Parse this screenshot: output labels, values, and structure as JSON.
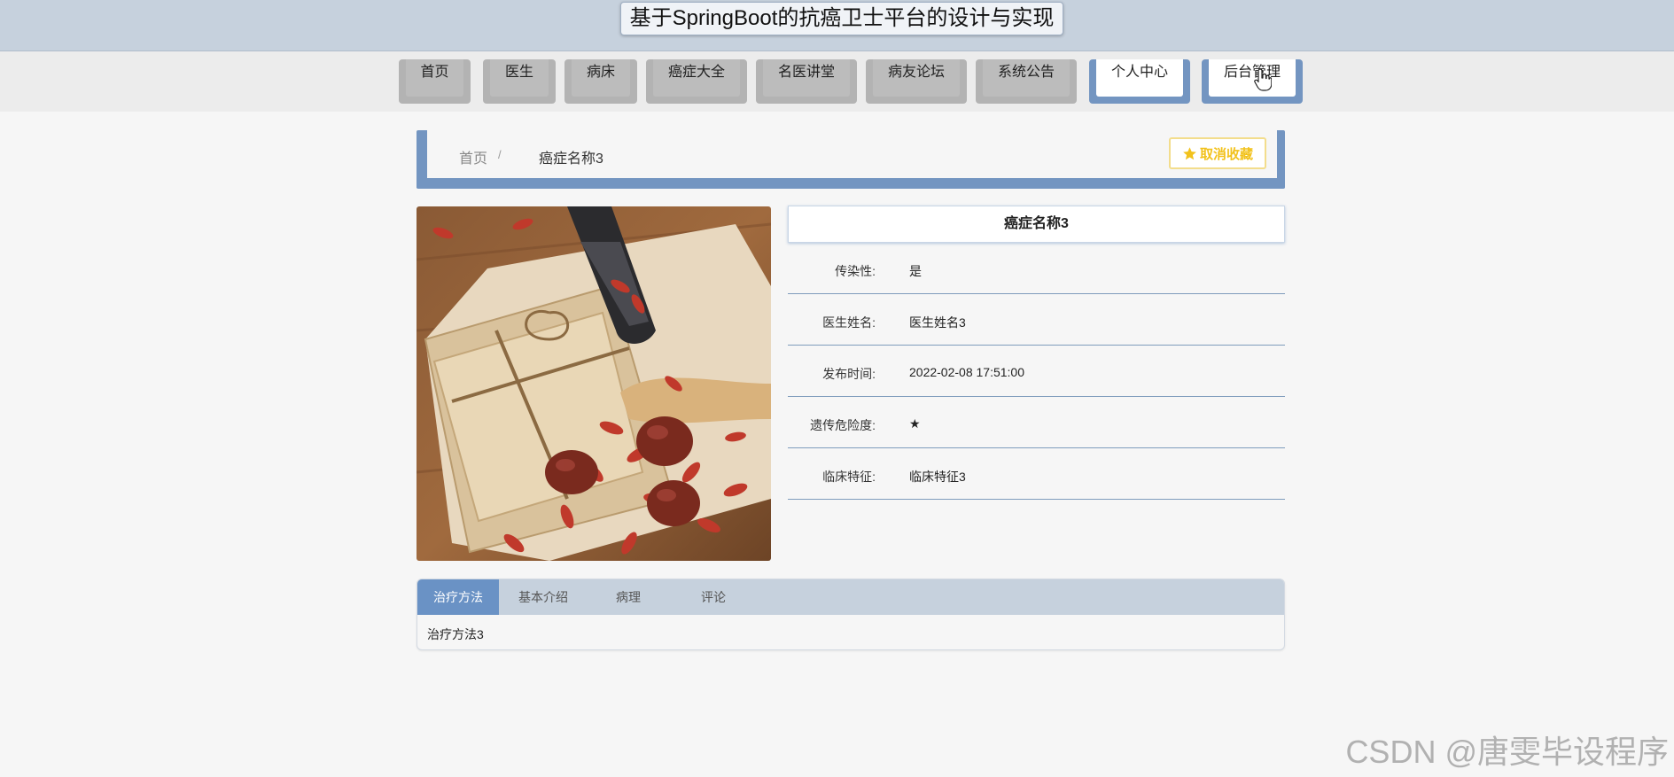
{
  "header": {
    "title": "基于SpringBoot的抗癌卫士平台的设计与实现"
  },
  "nav": {
    "items": [
      {
        "label": "首页",
        "active": false
      },
      {
        "label": "医生",
        "active": false
      },
      {
        "label": "病床",
        "active": false
      },
      {
        "label": "癌症大全",
        "active": false
      },
      {
        "label": "名医讲堂",
        "active": false
      },
      {
        "label": "病友论坛",
        "active": false
      },
      {
        "label": "系统公告",
        "active": false
      },
      {
        "label": "个人中心",
        "active": true
      },
      {
        "label": "后台管理",
        "active": true
      }
    ]
  },
  "breadcrumb": {
    "home": "首页",
    "separator": "/",
    "current": "癌症名称3"
  },
  "favorite": {
    "label": "取消收藏",
    "icon": "star-icon",
    "color": "#f2c21c"
  },
  "detail": {
    "title": "癌症名称3",
    "rows": [
      {
        "label": "传染性:",
        "value": "是"
      },
      {
        "label": "医生姓名:",
        "value": "医生姓名3"
      },
      {
        "label": "发布时间:",
        "value": "2022-02-08 17:51:00"
      },
      {
        "label": "遗传危险度:",
        "value": "★"
      },
      {
        "label": "临床特征:",
        "value": "临床特征3"
      }
    ]
  },
  "tabs": {
    "items": [
      {
        "label": "治疗方法",
        "active": true
      },
      {
        "label": "基本介绍",
        "active": false
      },
      {
        "label": "病理",
        "active": false
      },
      {
        "label": "评论",
        "active": false
      }
    ],
    "content": "治疗方法3"
  },
  "watermark": "CSDN @唐雯毕设程序",
  "colors": {
    "accent": "#7395c1",
    "header_bg": "#c6d1dd",
    "tab_active": "#6a92c5"
  }
}
